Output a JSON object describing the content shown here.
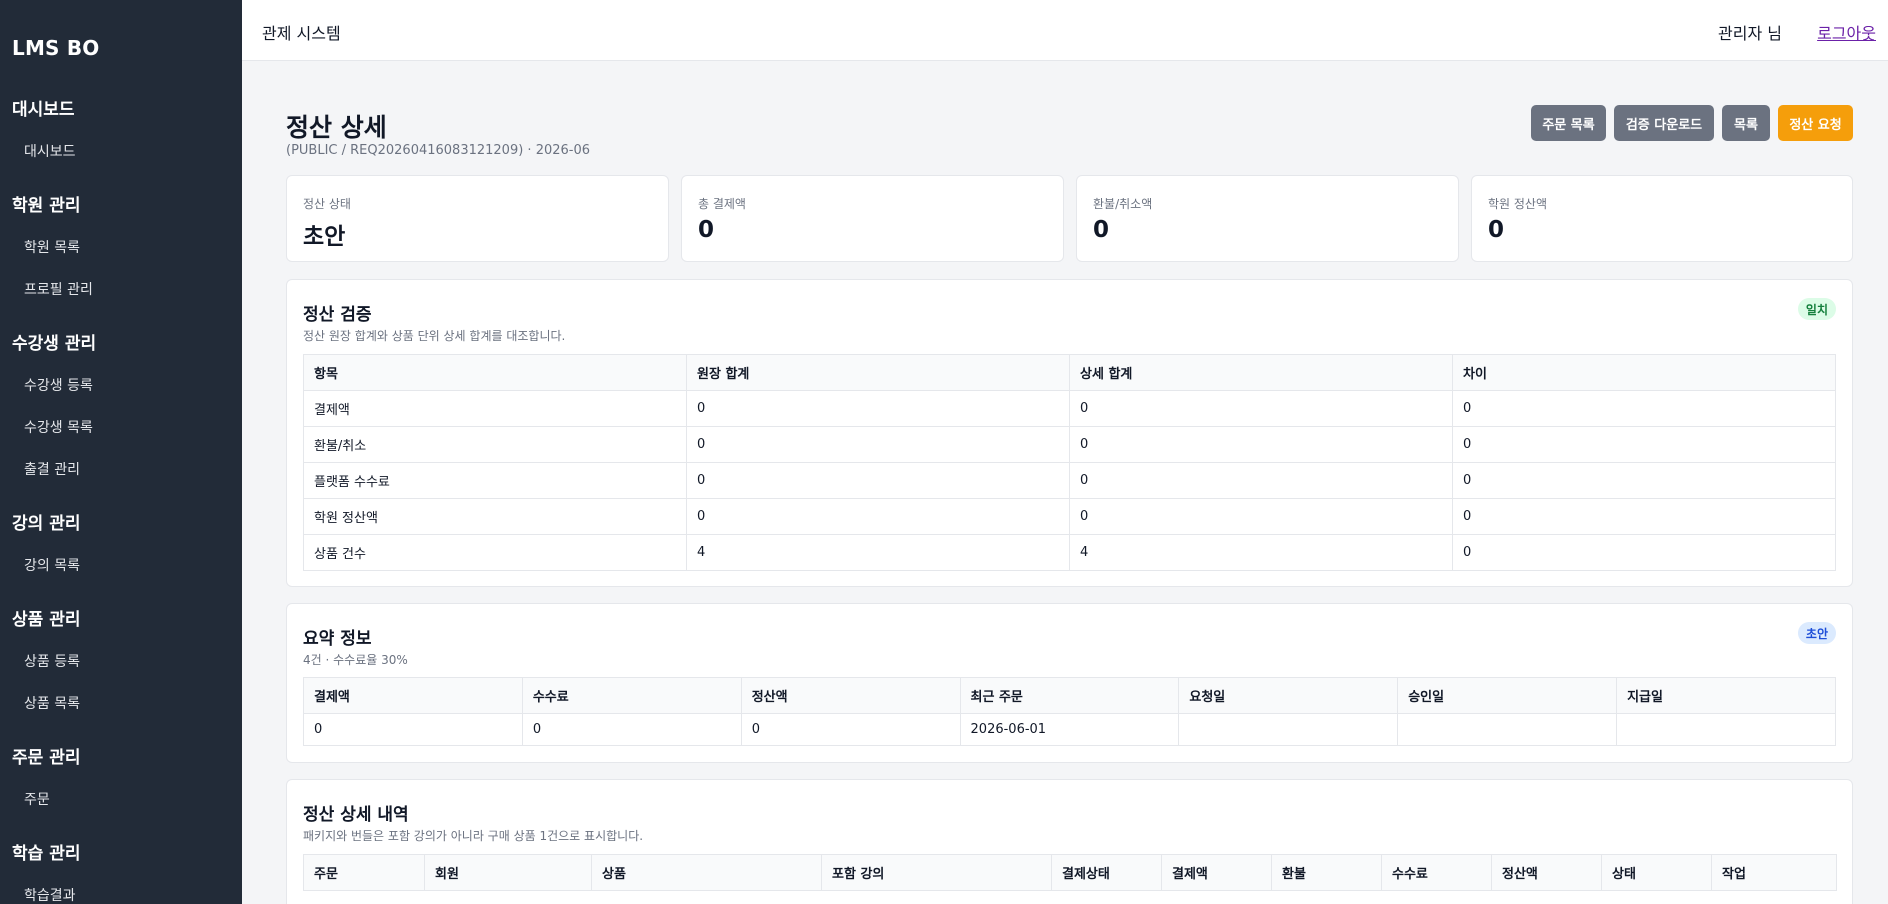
{
  "sidebar": {
    "brand": "LMS BO",
    "groups": [
      {
        "title": "대시보드",
        "items": [
          "대시보드"
        ]
      },
      {
        "title": "학원 관리",
        "items": [
          "학원 목록",
          "프로필 관리"
        ]
      },
      {
        "title": "수강생 관리",
        "items": [
          "수강생 등록",
          "수강생 목록",
          "출결 관리"
        ]
      },
      {
        "title": "강의 관리",
        "items": [
          "강의 목록"
        ]
      },
      {
        "title": "상품 관리",
        "items": [
          "상품 등록",
          "상품 목록"
        ]
      },
      {
        "title": "주문 관리",
        "items": [
          "주문"
        ]
      },
      {
        "title": "학습 관리",
        "items": [
          "학습결과"
        ]
      }
    ]
  },
  "header": {
    "title": "관제 시스템",
    "user": "관리자 님",
    "logout": "로그아웃"
  },
  "page": {
    "title": "정산 상세",
    "subtitle": "(PUBLIC / REQ20260416083121209) · 2026-06",
    "buttons": {
      "orders": "주문 목록",
      "verify_download": "검증 다운로드",
      "list": "목록",
      "request": "정산 요청"
    }
  },
  "stats": [
    {
      "label": "정산 상태",
      "value": "초안"
    },
    {
      "label": "총 결제액",
      "value": "0"
    },
    {
      "label": "환불/취소액",
      "value": "0"
    },
    {
      "label": "학원 정산액",
      "value": "0"
    }
  ],
  "verification": {
    "title": "정산 검증",
    "desc": "정산 원장 합계와 상품 단위 상세 합계를 대조합니다.",
    "badge": "일치",
    "columns": [
      "항목",
      "원장 합계",
      "상세 합계",
      "차이"
    ],
    "rows": [
      [
        "결제액",
        "0",
        "0",
        "0"
      ],
      [
        "환불/취소",
        "0",
        "0",
        "0"
      ],
      [
        "플랫폼 수수료",
        "0",
        "0",
        "0"
      ],
      [
        "학원 정산액",
        "0",
        "0",
        "0"
      ],
      [
        "상품 건수",
        "4",
        "4",
        "0"
      ]
    ]
  },
  "summary": {
    "title": "요약 정보",
    "desc": "4건 · 수수료율 30%",
    "badge": "초안",
    "columns": [
      "결제액",
      "수수료",
      "정산액",
      "최근 주문",
      "요청일",
      "승인일",
      "지급일"
    ],
    "row": [
      "0",
      "0",
      "0",
      "2026-06-01",
      "",
      "",
      ""
    ]
  },
  "details": {
    "title": "정산 상세 내역",
    "desc": "패키지와 번들은 포함 강의가 아니라 구매 상품 1건으로 표시합니다.",
    "columns": [
      "주문",
      "회원",
      "상품",
      "포함 강의",
      "결제상태",
      "결제액",
      "환불",
      "수수료",
      "정산액",
      "상태",
      "작업"
    ]
  },
  "colors": {
    "sidebar_bg": "#222b38",
    "accent_orange": "#f59e0b",
    "button_gray": "#6b7280",
    "match_badge": "#15803d",
    "draft_badge": "#1d4ed8"
  }
}
